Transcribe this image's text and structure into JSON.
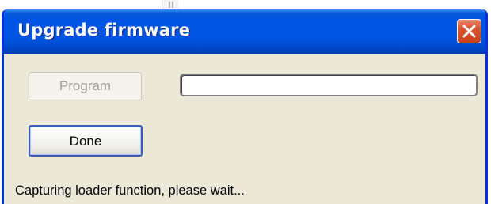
{
  "window": {
    "title": "Upgrade firmware",
    "close_icon": "close-icon",
    "accent_color": "#0054e3",
    "close_color": "#d9542f"
  },
  "buttons": {
    "program_label": "Program",
    "program_enabled": false,
    "done_label": "Done"
  },
  "progress": {
    "fraction": 0.0
  },
  "status": {
    "text": "Capturing loader function, please wait..."
  }
}
